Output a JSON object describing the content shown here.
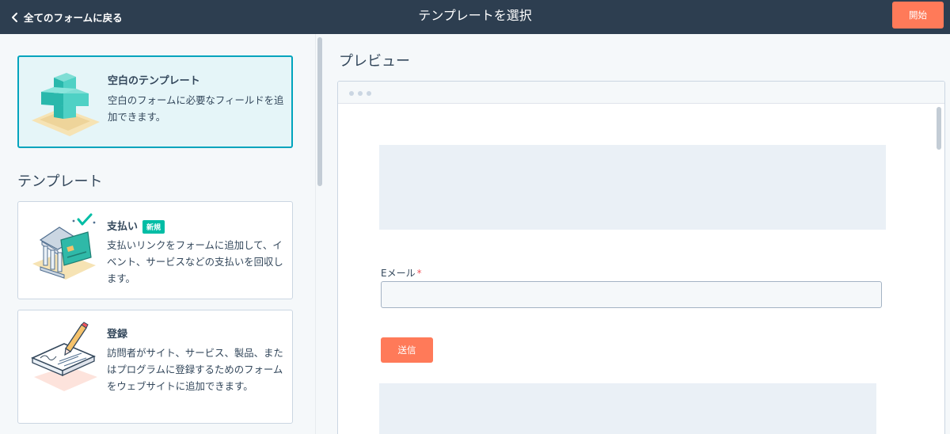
{
  "header": {
    "back_label": "全てのフォームに戻る",
    "title": "テンプレートを選択",
    "start_label": "開始"
  },
  "blank_template": {
    "title": "空白のテンプレート",
    "description": "空白のフォームに必要なフィールドを追加できます。"
  },
  "templates_section": {
    "title": "テンプレート",
    "items": [
      {
        "title": "支払い",
        "badge": "新規",
        "description": "支払いリンクをフォームに追加して、イベント、サービスなどの支払いを回収します。"
      },
      {
        "title": "登録",
        "description": "訪問者がサイト、サービス、製品、またはプログラムに登録するためのフォームをウェブサイトに追加できます。"
      }
    ]
  },
  "preview": {
    "title": "プレビュー",
    "email_label": "Eメール",
    "required_mark": "*",
    "email_value": "",
    "submit_label": "送信"
  },
  "colors": {
    "header_bg": "#2d3e50",
    "accent_orange": "#ff7a59",
    "selected_teal": "#00a4bd",
    "badge_green": "#00bda5"
  }
}
